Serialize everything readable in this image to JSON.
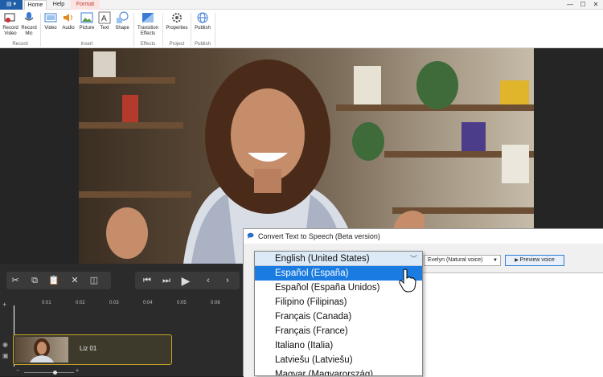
{
  "tabs": {
    "app": "▾",
    "home": "Home",
    "help": "Help",
    "format": "Format"
  },
  "window_controls": {
    "minimize": "—",
    "maximize": "☐",
    "close": "✕"
  },
  "ribbon": {
    "record_video": "Record Video",
    "record_mic": "Record Mic",
    "video": "Video",
    "audio": "Audio",
    "picture": "Picture",
    "text": "Text",
    "shape": "Shape",
    "transition_effects": "Transition Effects",
    "properties": "Properties",
    "publish": "Publish",
    "groups": {
      "record": "Record",
      "insert": "Insert",
      "effects": "Effects",
      "project": "Project",
      "publish": "Publish"
    }
  },
  "timeline": {
    "ticks": [
      "0:01",
      "0:02",
      "0:03",
      "0:04",
      "0:05",
      "0:06"
    ],
    "clip_label": "Liz 01"
  },
  "dialog": {
    "title": "Convert Text to Speech (Beta version)",
    "voice": "Evelyn (Natural voice)",
    "preview_button": "Preview voice"
  },
  "language_dropdown": {
    "selected": "English (United States)",
    "highlighted_index": 0,
    "options": [
      "Español (España)",
      "Español (España Unidos)",
      "Filipino (Filipinas)",
      "Français (Canada)",
      "Français (France)",
      "Italiano (Italia)",
      "Latviešu (Latviešu)",
      "Magyar (Magyarország)"
    ]
  },
  "colors": {
    "accent": "#1a7be0",
    "clip_border": "#c9a227",
    "format_tab": "#c0392b"
  }
}
